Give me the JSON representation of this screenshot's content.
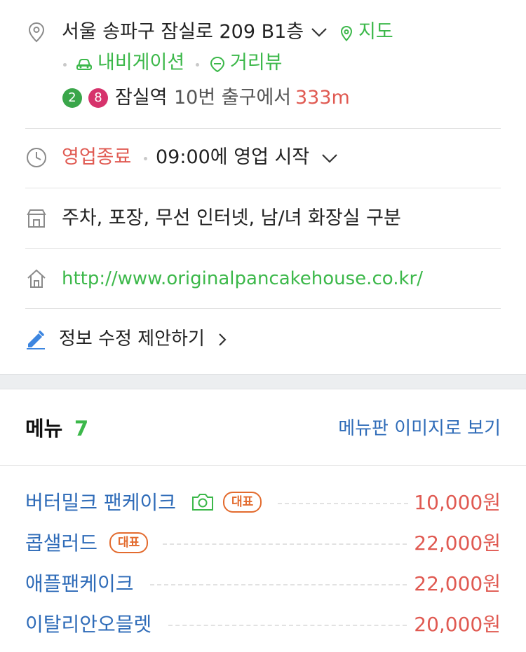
{
  "address": {
    "text": "서울 송파구 잠실로 209 B1층",
    "map_label": "지도",
    "navigation_label": "내비게이션",
    "streetview_label": "거리뷰"
  },
  "subway": {
    "lines": [
      "2",
      "8"
    ],
    "line_colors": [
      "#3aa64a",
      "#d6336c"
    ],
    "station": "잠실역",
    "exit_text": "10번 출구에서",
    "distance": "333m"
  },
  "hours": {
    "status": "영업종료",
    "text": "09:00에 영업 시작"
  },
  "amenities": {
    "text": "주차, 포장, 무선 인터넷, 남/녀 화장실 구분"
  },
  "homepage": {
    "url": "http://www.originalpancakehouse.co.kr/"
  },
  "edit": {
    "label": "정보 수정 제안하기"
  },
  "menu": {
    "title": "메뉴",
    "count": "7",
    "board_link": "메뉴판 이미지로 보기",
    "items": [
      {
        "name": "버터밀크 팬케이크",
        "badge": "대표",
        "price": "10,000원"
      },
      {
        "name": "콥샐러드",
        "badge": "대표",
        "price": "22,000원"
      },
      {
        "name": "애플팬케이크",
        "price": "22,000원"
      },
      {
        "name": "이탈리안오믈렛",
        "price": "20,000원"
      }
    ]
  },
  "colors": {
    "accent_green": "#3cb84a",
    "price_red": "#e05a52",
    "link_blue": "#2e6bb8",
    "badge_orange": "#e36b2e"
  }
}
